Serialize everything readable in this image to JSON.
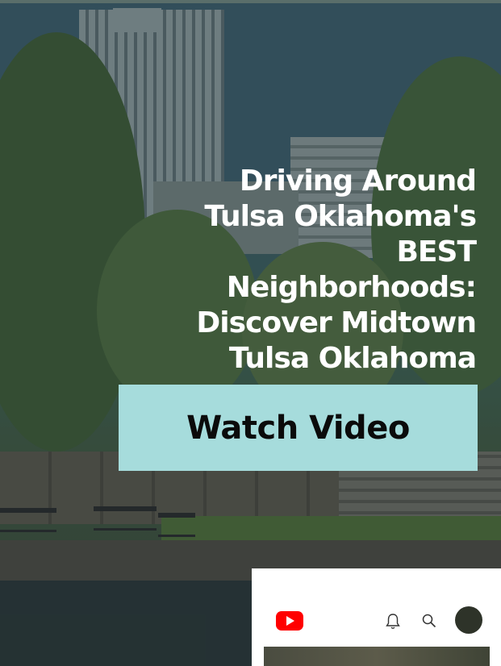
{
  "hero": {
    "headline_lines": [
      "Driving Around",
      "Tulsa Oklahoma's",
      "BEST",
      "Neighborhoods:",
      "Discover Midtown",
      "Tulsa Oklahoma"
    ],
    "cta_label": "Watch Video",
    "cta_color": "#a6dcdc",
    "headline_color": "#ffffff"
  },
  "youtube_card": {
    "logo_icon": "youtube-logo-icon",
    "notification_icon": "bell-icon",
    "search_icon": "search-icon",
    "avatar": "avatar"
  }
}
